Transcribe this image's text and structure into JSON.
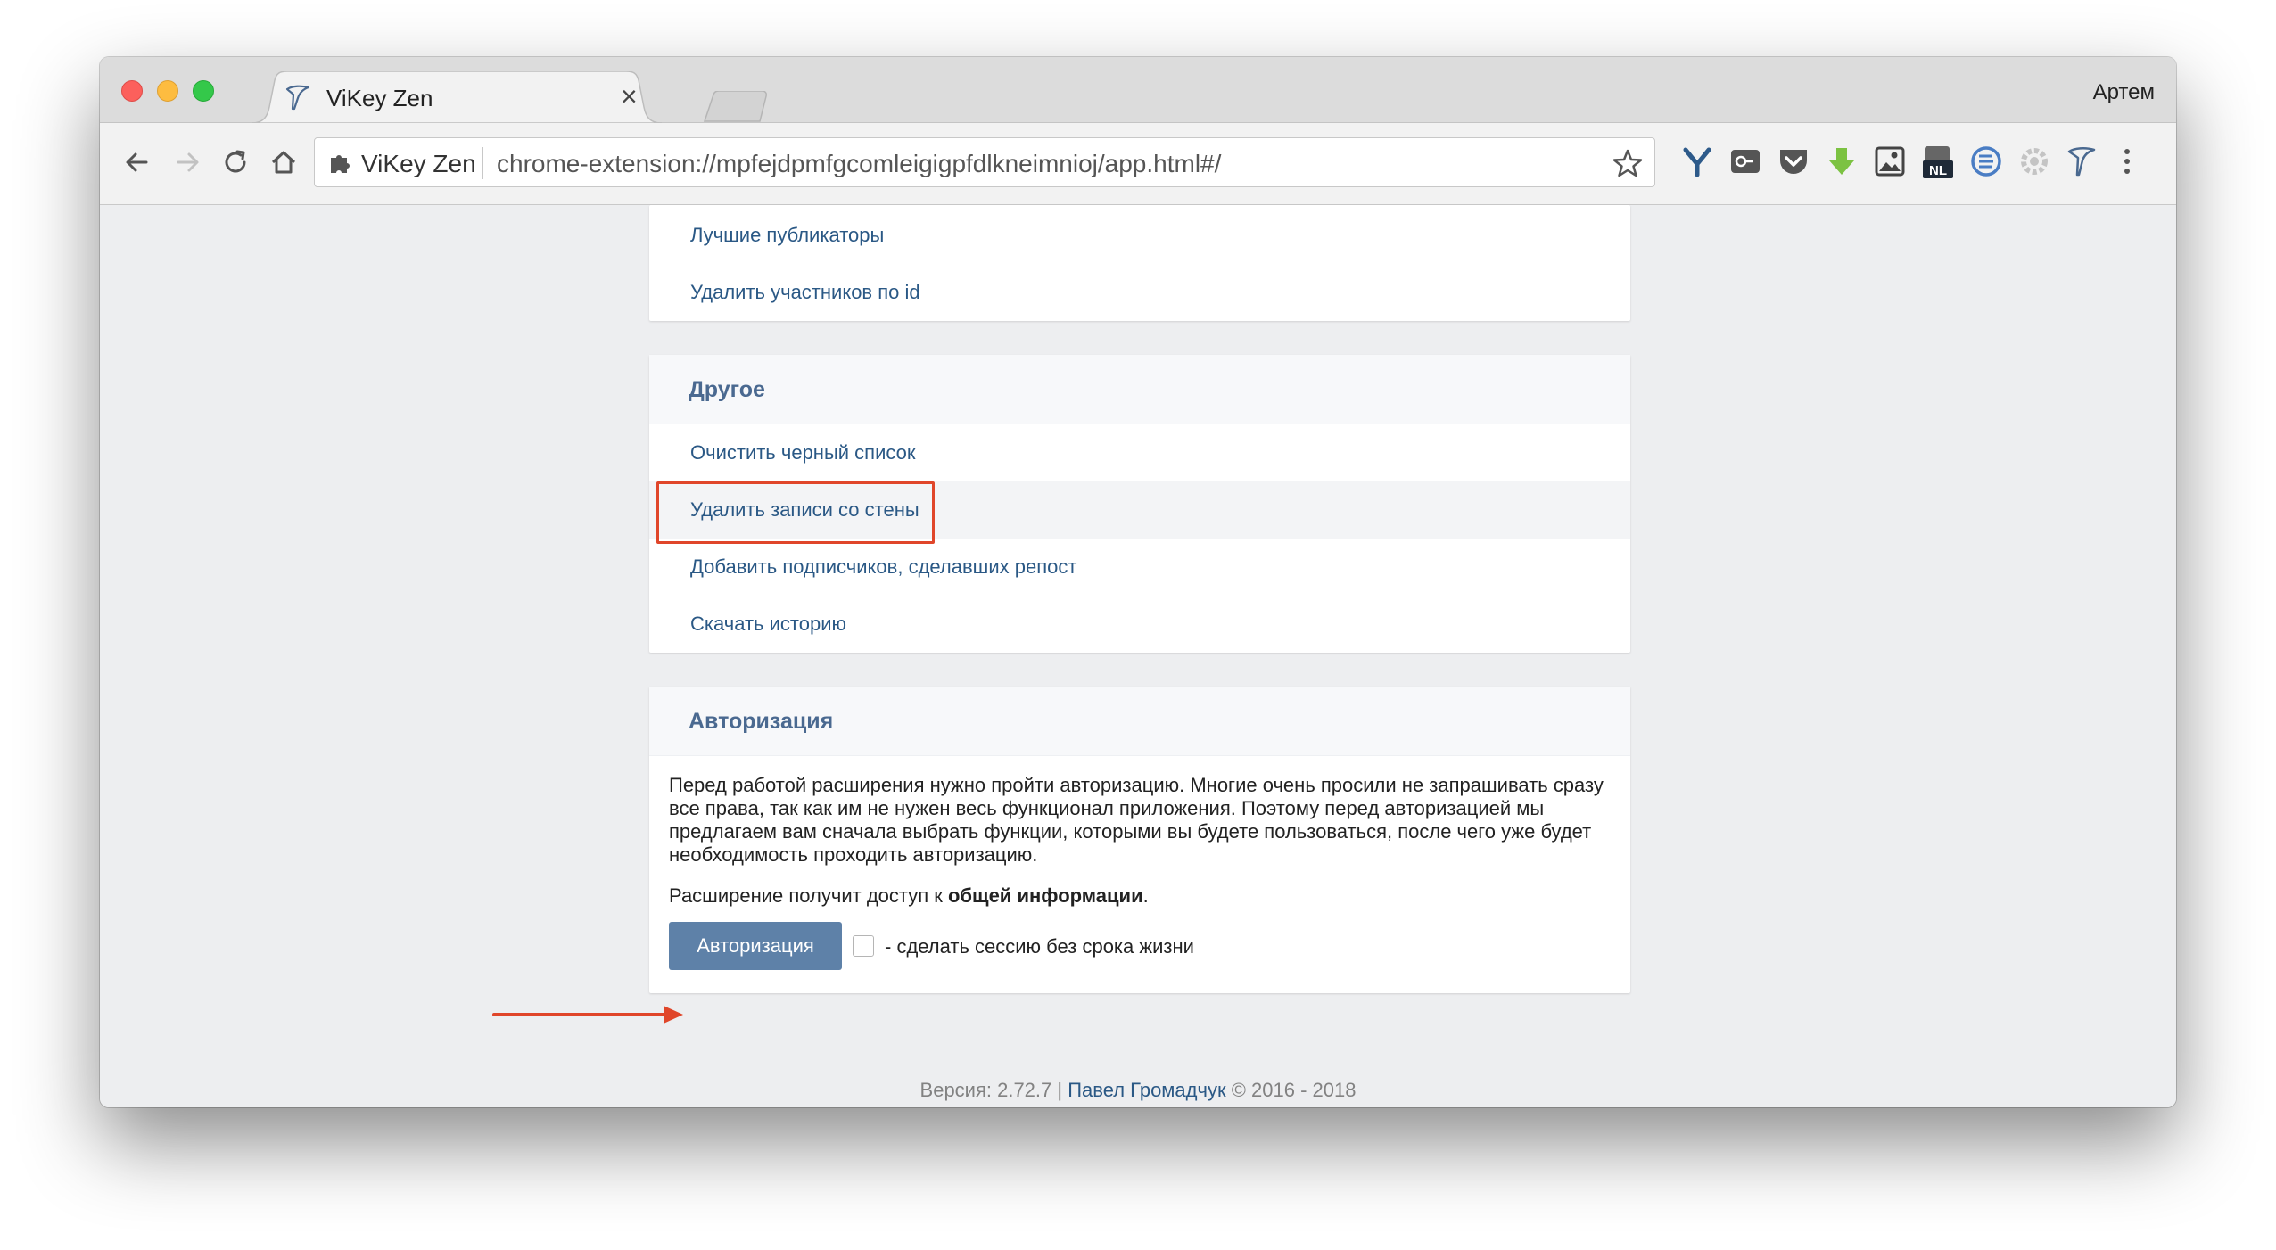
{
  "browser": {
    "tab_title": "ViKey Zen",
    "tab_close": "×",
    "profile_name": "Артем",
    "omnibox_site": "ViKey Zen",
    "omnibox_url": "chrome-extension://mpfejdpmfgcomleigigpfdlkneimnioj/app.html#/"
  },
  "sections": {
    "top": {
      "items": [
        "Лучшие публикаторы",
        "Удалить участников по id"
      ]
    },
    "other": {
      "title": "Другое",
      "items": [
        "Очистить черный список",
        "Удалить записи со стены",
        "Добавить подписчиков, сделавших репост",
        "Скачать историю"
      ]
    },
    "auth": {
      "title": "Авторизация",
      "description": "Перед работой расширения нужно пройти авторизацию. Многие очень просили не запрашивать сразу все права, так как им не нужен весь функционал приложения. Поэтому перед авторизацией мы предлагаем вам сначала выбрать функции, которыми вы будете пользоваться, после чего уже будет необходимость проходить авторизацию.",
      "access_prefix": "Расширение получит доступ к ",
      "access_bold": "общей информации",
      "access_suffix": ".",
      "button_label": "Авторизация",
      "checkbox_label": "- сделать сессию без срока жизни"
    }
  },
  "footer": {
    "version": "Версия: 2.72.7 | ",
    "author": "Павел Громадчук",
    "copyright": " © 2016 - 2018"
  },
  "colors": {
    "link": "#2a5885",
    "header_text": "#4a6990",
    "button": "#5e81a8",
    "annotation": "#e0462a"
  }
}
